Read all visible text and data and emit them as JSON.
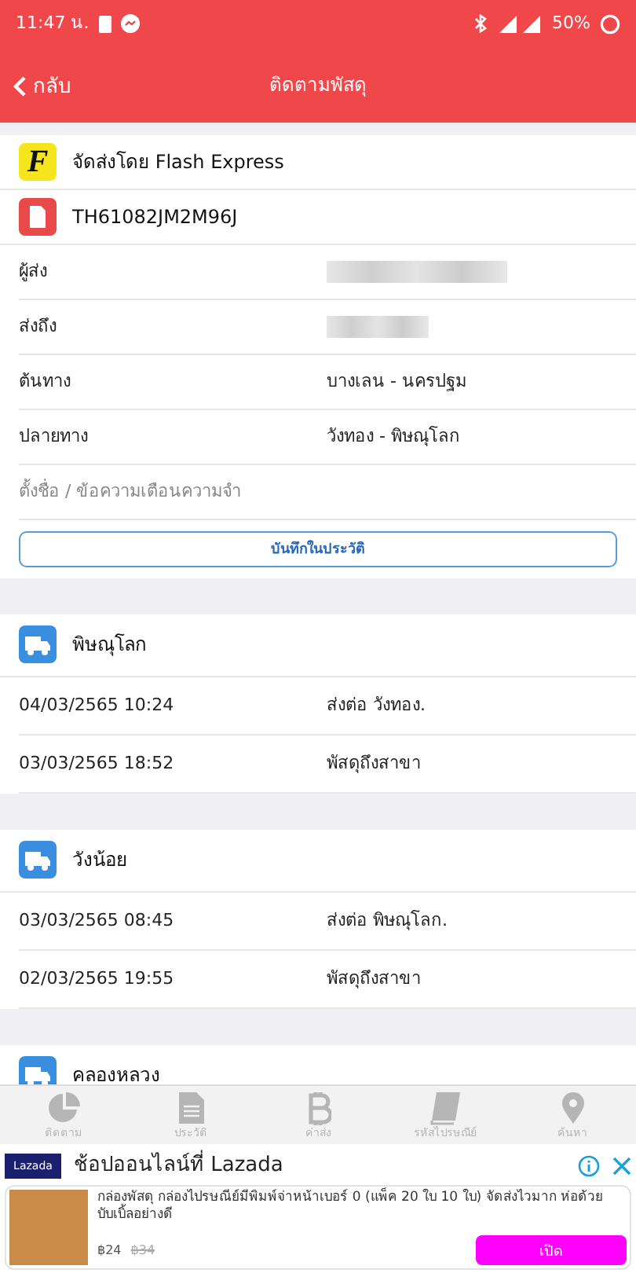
{
  "status_bar": {
    "time": "11:47 น.",
    "battery": "50%"
  },
  "nav": {
    "back": "กลับ",
    "title": "ติดตามพัสดุ"
  },
  "carrier": {
    "logo": "F",
    "name": "จัดส่งโดย Flash Express",
    "tracking": "TH61082JM2M96J"
  },
  "details": [
    {
      "label": "ผู้ส่ง",
      "blurred": true
    },
    {
      "label": "ส่งถึง",
      "blurred": true
    },
    {
      "label": "ต้นทาง",
      "value": "บางเลน - นครปฐม",
      "blurred": false
    },
    {
      "label": "ปลายทาง",
      "value": "วังทอง - พิษณุโลก",
      "blurred": false
    }
  ],
  "note_field": {
    "placeholder": "ตั้งชื่อ / ข้อความเตือนความจำ"
  },
  "save_button": "บันทึกในประวัติ",
  "groups": [
    {
      "place": "พิษณุโลก",
      "events": [
        {
          "time": "04/03/2565 10:24",
          "status": "ส่งต่อ วังทอง."
        },
        {
          "time": "03/03/2565 18:52",
          "status": "พัสดุถึงสาขา"
        }
      ]
    },
    {
      "place": "วังน้อย",
      "events": [
        {
          "time": "03/03/2565 08:45",
          "status": "ส่งต่อ พิษณุโลก."
        },
        {
          "time": "02/03/2565 19:55",
          "status": "พัสดุถึงสาขา"
        }
      ]
    },
    {
      "place": "คลองหลวง"
    }
  ],
  "tabs": [
    {
      "label": "ติดตาม",
      "kind": "pie",
      "selected": false
    },
    {
      "label": "ประวัติ",
      "kind": "document",
      "selected": false
    },
    {
      "label": "ค่าส่ง",
      "kind": "coin",
      "selected": false
    },
    {
      "label": "รหัสไปรษณีย์",
      "kind": "book",
      "selected": false
    },
    {
      "label": "ค้นหา",
      "kind": "pin",
      "selected": false
    }
  ],
  "ad": {
    "logo": "Lazada",
    "title": "ช้อปออนไลน์ที่ Lazada",
    "text": "กล่องพัสดุ กล่องไปรษณีย์มีพิมพ์จ่าหน้าเบอร์ 0 (แพ็ค 20 ใบ 10 ใบ) จัดส่งไวมาก ห่อด้วยบับเบิ้ลอย่างดี",
    "price": "฿24",
    "old_price": "฿34",
    "button": "เปิด"
  }
}
